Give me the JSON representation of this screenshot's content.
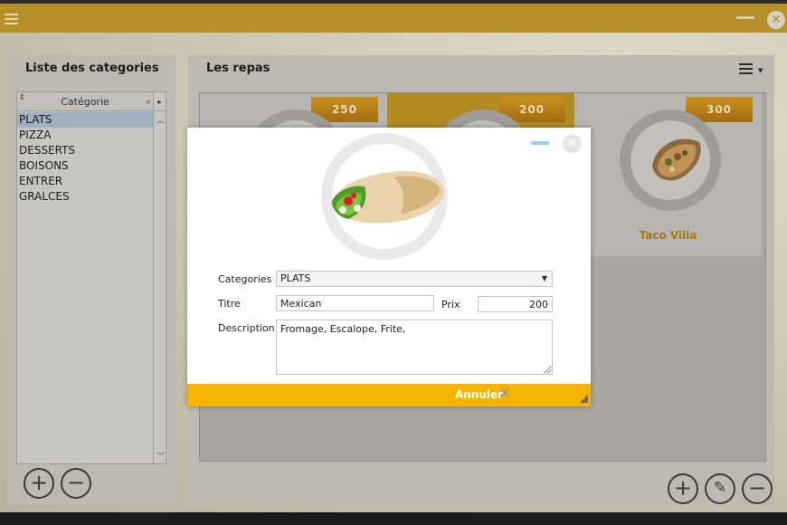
{
  "window": {
    "minimize_icon": "minimize-icon",
    "close_icon": "close-circle-icon",
    "menu_icon": "hamburger-icon",
    "accent_color": "#f6b400"
  },
  "left_panel": {
    "title": "Liste des categories",
    "column_header": "Catégorie",
    "categories": [
      "PLATS",
      "PIZZA",
      "DESSERTS",
      "BOISONS",
      "ENTRER",
      "GRALCES"
    ],
    "selected": "PLATS",
    "add_label": "+",
    "remove_label": "−"
  },
  "right_panel": {
    "title": "Les repas",
    "meals": [
      {
        "price": "250",
        "name": ""
      },
      {
        "price": "200",
        "name": ""
      },
      {
        "price": "300",
        "name": "Taco Villa"
      }
    ],
    "add_label": "+",
    "edit_label": "✎",
    "remove_label": "−"
  },
  "dialog": {
    "labels": {
      "categories": "Categories",
      "titre": "Titre",
      "prix": "Prix",
      "description": "Description"
    },
    "values": {
      "categorie": "PLATS",
      "titre": "Mexican",
      "prix": "200",
      "description": "Fromage, Escalope, Frite,"
    },
    "cancel_label": "Annuler",
    "cancel_icon": "✕"
  }
}
